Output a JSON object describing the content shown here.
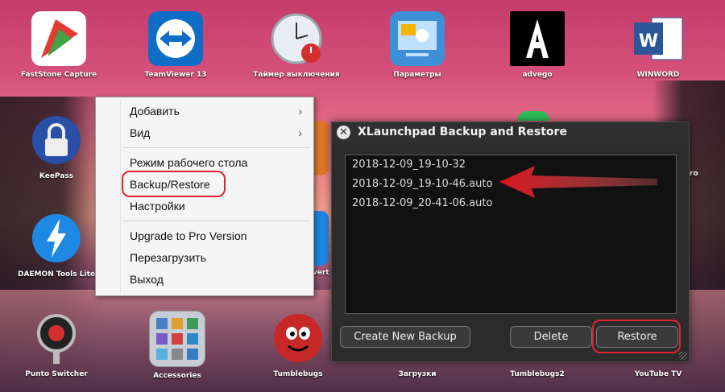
{
  "desktop": {
    "icons": [
      {
        "label": "FastStone Capture",
        "icon": "faststone-icon"
      },
      {
        "label": "TeamViewer 13",
        "icon": "teamviewer-icon"
      },
      {
        "label": "Таймер выключения",
        "icon": "timer-icon"
      },
      {
        "label": "Параметры",
        "icon": "settings-icon"
      },
      {
        "label": "advego",
        "icon": "advego-icon"
      },
      {
        "label": "WINWORD",
        "icon": "word-icon"
      },
      {
        "label": "KeePass",
        "icon": "keepass-icon"
      },
      {
        "label": "DAEMON Tools Lite",
        "icon": "daemon-tools-icon"
      },
      {
        "label": "Punto Switcher",
        "icon": "punto-switcher-icon"
      },
      {
        "label": "Accessories",
        "icon": "accessories-icon"
      },
      {
        "label": "Tumblebugs",
        "icon": "tumblebugs-icon"
      },
      {
        "label": "Загрузки",
        "icon": "downloads-icon"
      },
      {
        "label": "Tumblebugs2",
        "icon": "tumblebugs2-icon"
      },
      {
        "label": "YouTube TV",
        "icon": "youtube-tv-icon"
      }
    ],
    "partial_labels": {
      "pro": "ro",
      "invert": "vert"
    }
  },
  "context_menu": {
    "items": [
      {
        "label": "Добавить",
        "submenu": true
      },
      {
        "label": "Вид",
        "submenu": true
      },
      {
        "label": "Режим рабочего стола",
        "submenu": false
      },
      {
        "label": "Backup/Restore",
        "submenu": false
      },
      {
        "label": "Настройки",
        "submenu": false
      },
      {
        "label": "Upgrade to Pro Version",
        "submenu": false
      },
      {
        "label": "Перезагрузить",
        "submenu": false
      },
      {
        "label": "Выход",
        "submenu": false
      }
    ],
    "submenu_glyph": "›"
  },
  "backup_window": {
    "close_glyph": "✕",
    "title": "XLaunchpad Backup and Restore",
    "backups": [
      "2018-12-09_19-10-32",
      "2018-12-09_19-10-46.auto",
      "2018-12-09_20-41-06.auto"
    ],
    "buttons": {
      "create": "Create New Backup",
      "delete": "Delete",
      "restore": "Restore"
    }
  },
  "colors": {
    "highlight_ring": "#e0242c",
    "window_bg": "#2b2b2b",
    "list_bg": "#111111"
  }
}
